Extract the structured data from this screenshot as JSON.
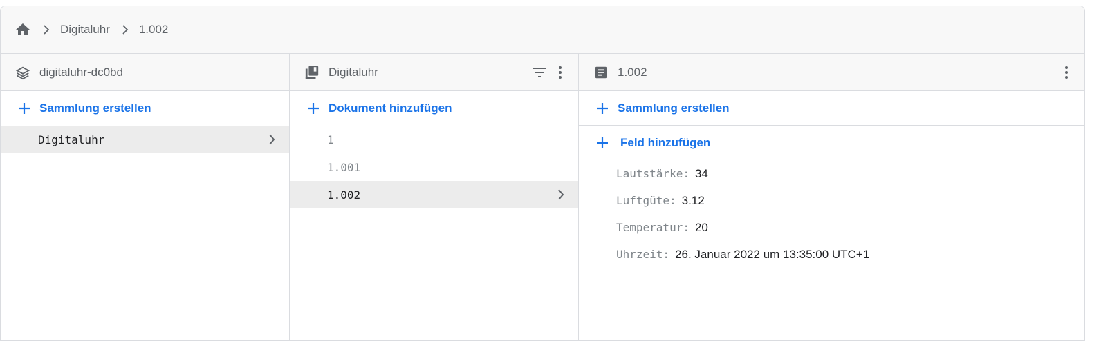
{
  "breadcrumb": {
    "home_icon": "home-icon",
    "items": [
      "Digitaluhr",
      "1.002"
    ]
  },
  "panel_root": {
    "title": "digitaluhr-dc0bd",
    "icon": "firestore-layers-icon",
    "action_label": "Sammlung erstellen",
    "collections": [
      {
        "label": "Digitaluhr",
        "selected": true
      }
    ]
  },
  "panel_collection": {
    "title": "Digitaluhr",
    "icon": "collection-icon",
    "action_label": "Dokument hinzufügen",
    "documents": [
      {
        "label": "1",
        "selected": false
      },
      {
        "label": "1.001",
        "selected": false
      },
      {
        "label": "1.002",
        "selected": true
      }
    ]
  },
  "panel_document": {
    "title": "1.002",
    "icon": "document-icon",
    "action_collection_label": "Sammlung erstellen",
    "action_field_label": "Feld hinzufügen",
    "fields": [
      {
        "key": "Lautstärke:",
        "value": "34"
      },
      {
        "key": "Luftgüte:",
        "value": "3.12"
      },
      {
        "key": "Temperatur:",
        "value": "20"
      },
      {
        "key": "Uhrzeit:",
        "value": "26. Januar 2022 um 13:35:00 UTC+1"
      }
    ]
  },
  "colors": {
    "accent": "#1a73e8",
    "text_secondary": "#5f6368",
    "selected_bg": "#ececec",
    "header_bg": "#f8f8f8"
  }
}
